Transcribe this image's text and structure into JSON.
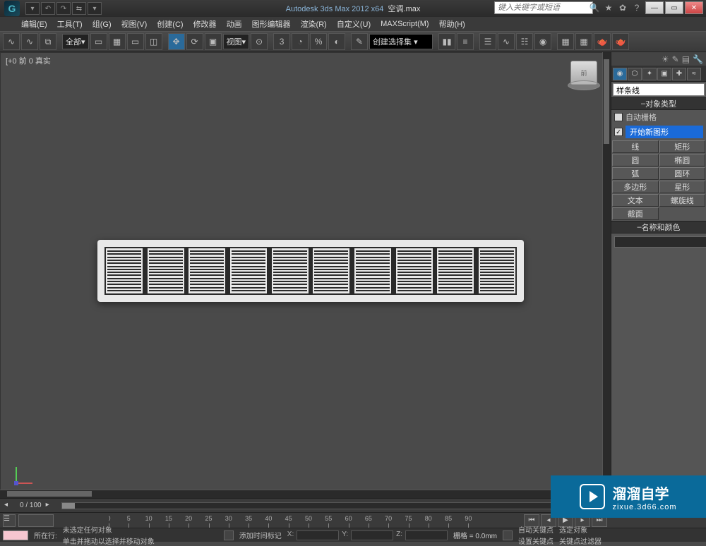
{
  "app": {
    "title_prefix": "Autodesk 3ds Max  2012 x64",
    "filename": "空调.max",
    "search_placeholder": "键入关键字或短语"
  },
  "menus": [
    "编辑(E)",
    "工具(T)",
    "组(G)",
    "视图(V)",
    "创建(C)",
    "修改器",
    "动画",
    "图形编辑器",
    "渲染(R)",
    "自定义(U)",
    "MAXScript(M)",
    "帮助(H)"
  ],
  "toolbar": {
    "selection_set": "全部",
    "view_combo": "视图"
  },
  "viewport": {
    "label": "[+0 前 0 真实"
  },
  "panel": {
    "dropdown": "样条线",
    "section_objtype": "对象类型",
    "auto_grid_label": "自动栅格",
    "start_new_shape": "开始新图形",
    "buttons": [
      [
        "线",
        "矩形"
      ],
      [
        "圆",
        "椭圆"
      ],
      [
        "弧",
        "圆环"
      ],
      [
        "多边形",
        "星形"
      ],
      [
        "文本",
        "螺旋线"
      ],
      [
        "截面",
        ""
      ]
    ],
    "section_namecolor": "名称和颜色"
  },
  "timeline": {
    "frame": "0 / 100"
  },
  "status": {
    "none_selected": "未选定任何对象",
    "prompt": "单击并拖动以选择并移动对象",
    "x": "X:",
    "y": "Y:",
    "z": "Z:",
    "grid_label": "栅格 = 0.0mm",
    "autokey": "自动关键点",
    "selset_label": "选定对象",
    "setkey": "设置关键点",
    "keyfilter": "关键点过滤器",
    "addtime": "添加时间标记",
    "row_label": "所在行:"
  },
  "watermark": {
    "big": "溜溜自学",
    "small": "zixue.3d66.com"
  }
}
